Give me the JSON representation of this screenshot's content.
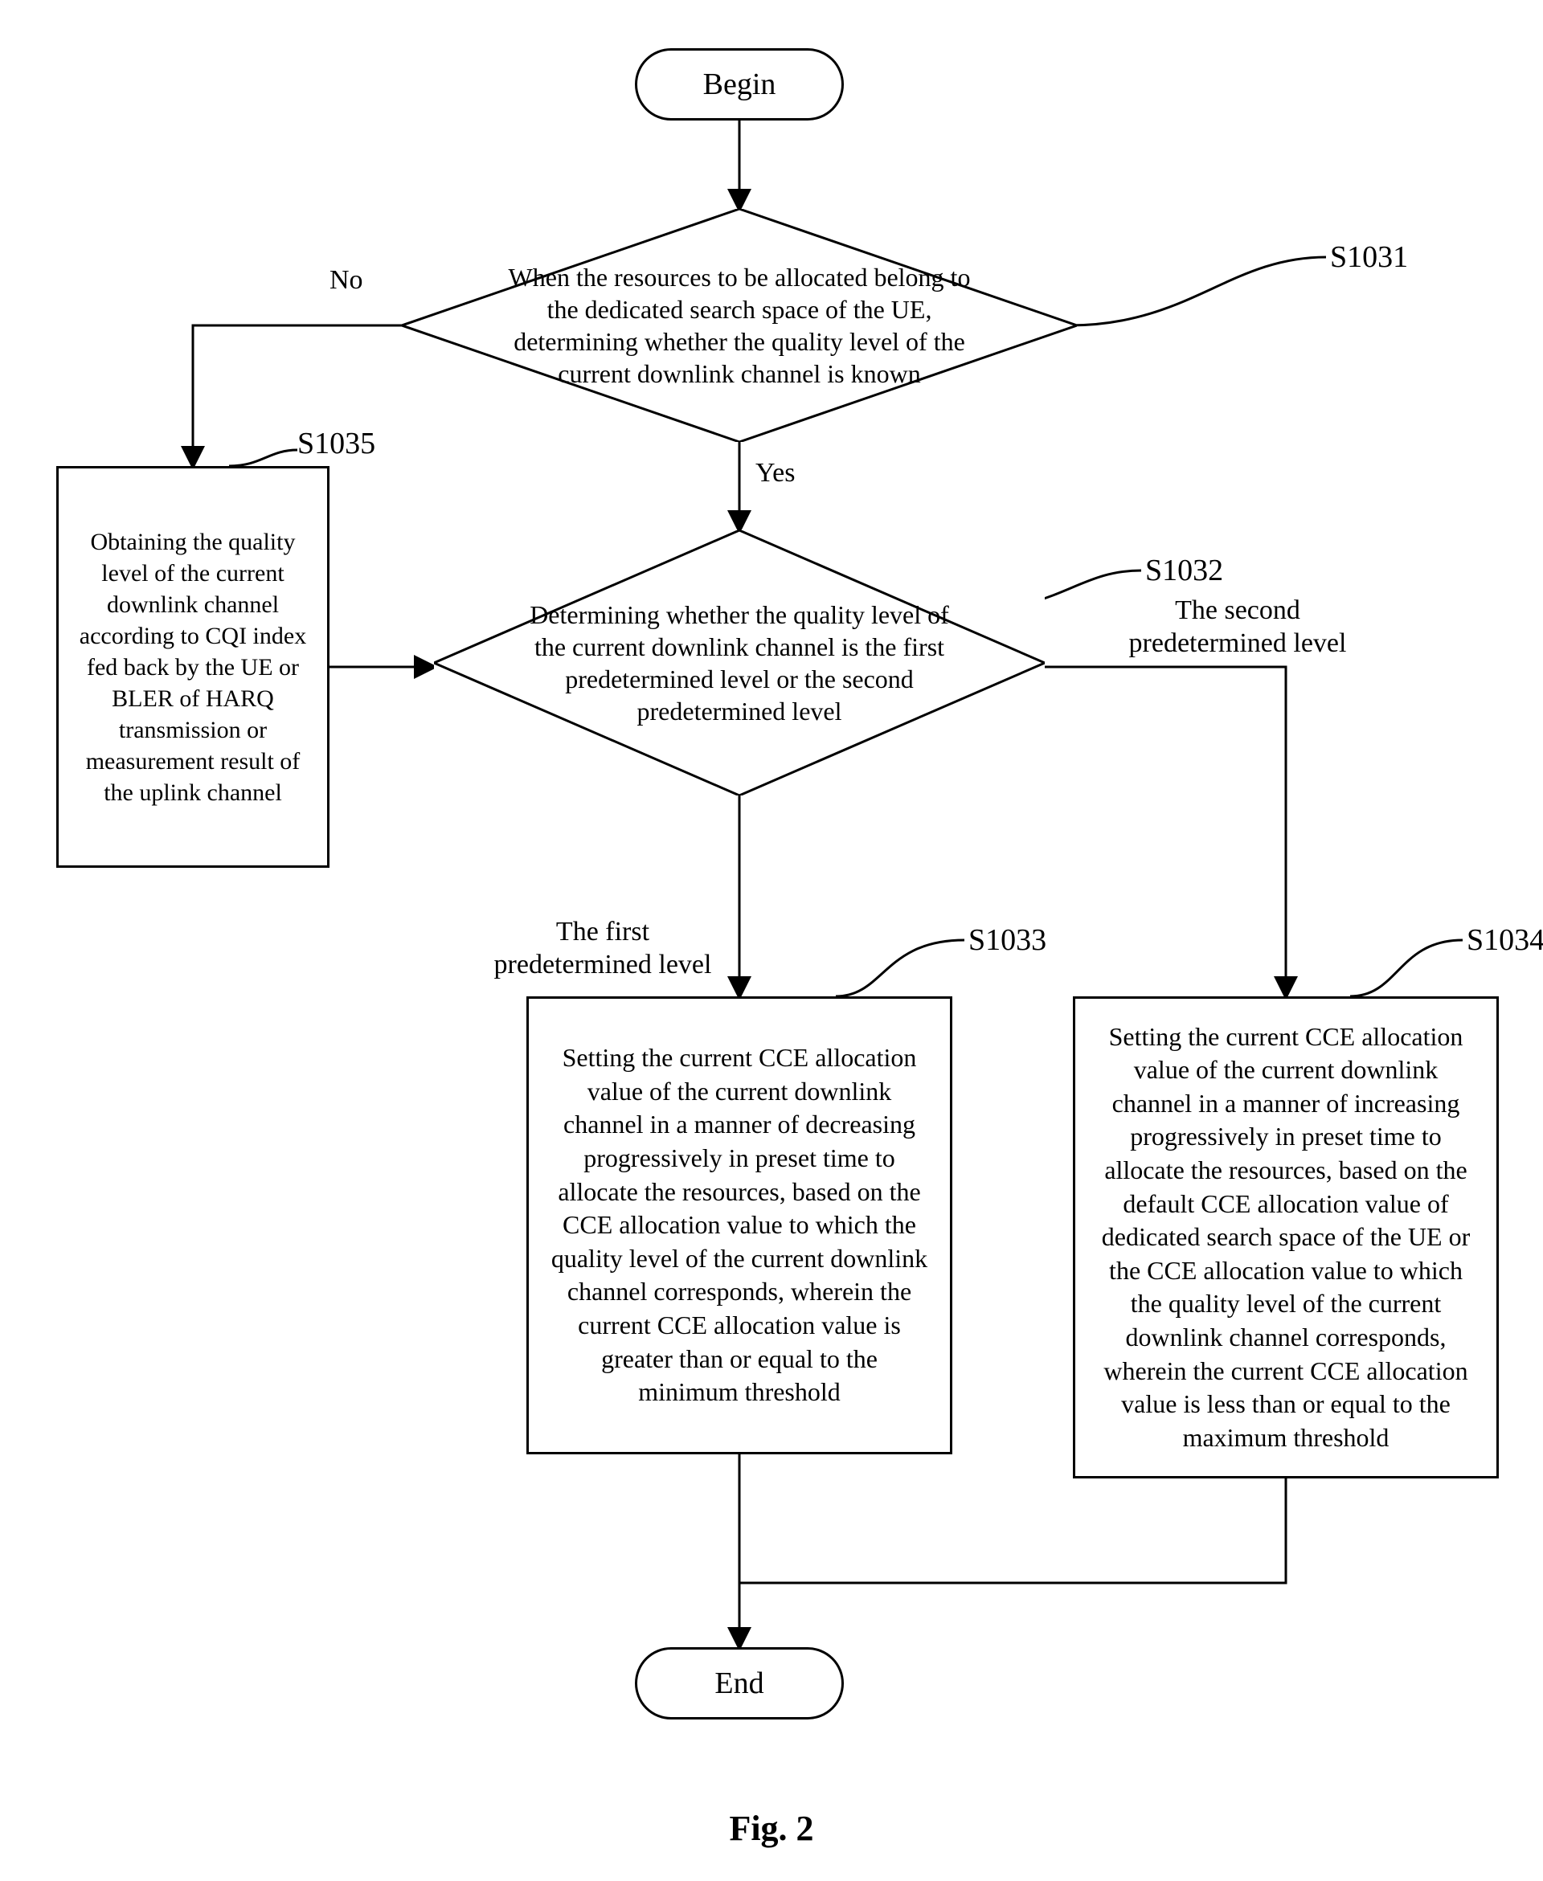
{
  "flow": {
    "begin": "Begin",
    "end": "End",
    "s1031": {
      "id": "S1031",
      "text": "When the resources to be allocated belong to the dedicated search space of the UE, determining whether the quality level of the current downlink channel is known",
      "no_label": "No",
      "yes_label": "Yes"
    },
    "s1035": {
      "id": "S1035",
      "text": "Obtaining the quality level of the current downlink channel according to CQI index fed back by the UE or BLER of HARQ transmission or measurement result of the uplink channel"
    },
    "s1032": {
      "id": "S1032",
      "text": "Determining whether the quality level of the current downlink channel is the first predetermined level or the second predetermined level",
      "first_label": "The first predetermined level",
      "second_label": "The second predetermined level"
    },
    "s1033": {
      "id": "S1033",
      "text": "Setting the current CCE allocation value of the current downlink channel in a manner of decreasing progressively in preset time to allocate the resources, based on the CCE allocation value to which the quality level of the current downlink channel corresponds, wherein the current CCE allocation value is greater than or equal to the minimum threshold"
    },
    "s1034": {
      "id": "S1034",
      "text": "Setting the current CCE allocation value of the current downlink channel in a manner of increasing progressively in preset time to allocate the resources, based on the default CCE allocation value of dedicated search space of the UE or the CCE allocation value to which the quality level of the current downlink channel corresponds, wherein the current CCE allocation value is less than or equal to the maximum threshold"
    }
  },
  "caption": "Fig. 2"
}
